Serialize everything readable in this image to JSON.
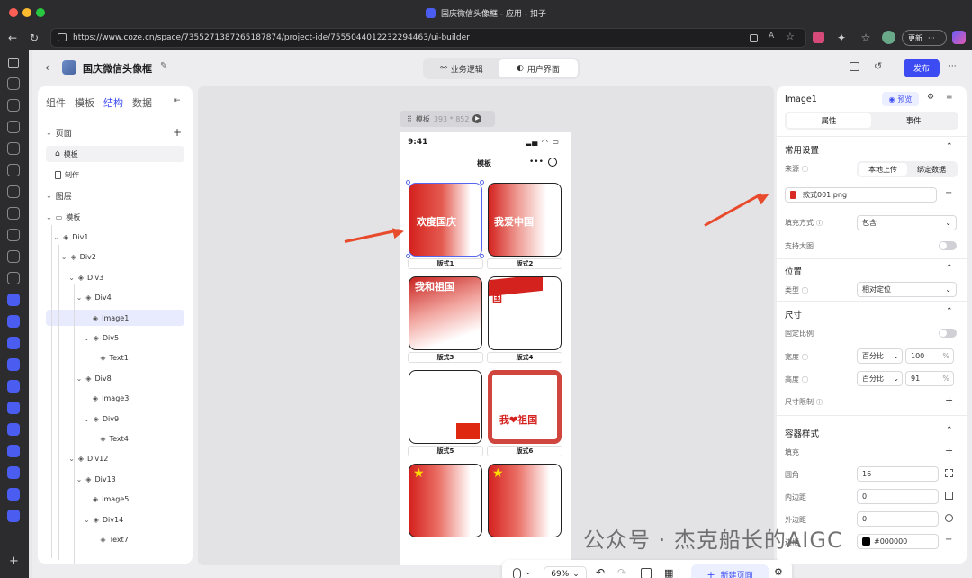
{
  "browser": {
    "tab_title": "国庆微信头像框 - 应用 - 扣子",
    "url": "https://www.coze.cn/space/7355271387265187874/project-ide/7555044012232294463/ui-builder",
    "update_label": "更新",
    "update_more": "···"
  },
  "header": {
    "project_name": "国庆微信头像框",
    "tab_logic": "业务逻辑",
    "tab_ui": "用户界面",
    "publish_label": "发布",
    "more": "···"
  },
  "left_panel": {
    "tabs": [
      "组件",
      "模板",
      "结构",
      "数据"
    ],
    "active_tab": "结构",
    "pages_section": "页面",
    "pages": [
      "模板",
      "制作"
    ],
    "layers_section": "图层",
    "layers": [
      {
        "label": "模板",
        "depth": 0,
        "kind": "page"
      },
      {
        "label": "Div1",
        "depth": 1,
        "kind": "div"
      },
      {
        "label": "Div2",
        "depth": 2,
        "kind": "div"
      },
      {
        "label": "Div3",
        "depth": 3,
        "kind": "div"
      },
      {
        "label": "Div4",
        "depth": 4,
        "kind": "div"
      },
      {
        "label": "Image1",
        "depth": 5,
        "kind": "leaf",
        "selected": true
      },
      {
        "label": "Div5",
        "depth": 5,
        "kind": "div"
      },
      {
        "label": "Text1",
        "depth": 6,
        "kind": "leaf"
      },
      {
        "label": "Div8",
        "depth": 4,
        "kind": "div"
      },
      {
        "label": "Image3",
        "depth": 5,
        "kind": "leaf"
      },
      {
        "label": "Div9",
        "depth": 5,
        "kind": "div"
      },
      {
        "label": "Text4",
        "depth": 6,
        "kind": "leaf"
      },
      {
        "label": "Div12",
        "depth": 3,
        "kind": "div"
      },
      {
        "label": "Div13",
        "depth": 4,
        "kind": "div"
      },
      {
        "label": "Image5",
        "depth": 5,
        "kind": "leaf"
      },
      {
        "label": "Div14",
        "depth": 5,
        "kind": "div"
      },
      {
        "label": "Text7",
        "depth": 6,
        "kind": "leaf"
      }
    ]
  },
  "canvas": {
    "tag_label": "模板",
    "tag_size": "393 * 852",
    "phone_time": "9:41",
    "phone_title": "模板",
    "frames": [
      {
        "label": "版式1",
        "text": "欢度国庆"
      },
      {
        "label": "版式2",
        "text": "我爱中国"
      },
      {
        "label": "版式3",
        "text": "我和祖国"
      },
      {
        "label": "版式4",
        "text": "我爱你中国"
      },
      {
        "label": "版式5",
        "text": ""
      },
      {
        "label": "版式6",
        "text": "我❤祖国"
      },
      {
        "label": "",
        "text": ""
      },
      {
        "label": "",
        "text": ""
      }
    ],
    "zoom": "69%",
    "new_page_label": "新建页面"
  },
  "right_panel": {
    "component_name": "Image1",
    "preview_label": "预览",
    "tab_props": "属性",
    "tab_events": "事件",
    "common_section": "常用设置",
    "source_label": "来源",
    "source_local": "本地上传",
    "source_bind": "绑定数据",
    "file_name": "款式001.png",
    "fill_label": "填充方式",
    "fill_value": "包含",
    "zoom_label": "支持大图",
    "position_section": "位置",
    "type_label": "类型",
    "type_value": "相对定位",
    "size_section": "尺寸",
    "ratio_label": "固定比例",
    "width_label": "宽度",
    "width_unit": "百分比",
    "width_value": "100",
    "height_label": "高度",
    "height_unit": "百分比",
    "height_value": "91",
    "pct": "%",
    "limit_label": "尺寸限制",
    "container_section": "容器样式",
    "fill2_label": "填充",
    "radius_label": "圆角",
    "radius_value": "16",
    "padding_label": "内边距",
    "padding_value": "0",
    "margin_label": "外边距",
    "margin_value": "0",
    "border_label": "边框",
    "border_value": "#000000"
  },
  "watermark": "公众号 · 杰克船长的AIGC",
  "colors": {
    "accent": "#3d4cf2",
    "arrow": "#e84a2c",
    "festive_red": "#d92a24"
  }
}
